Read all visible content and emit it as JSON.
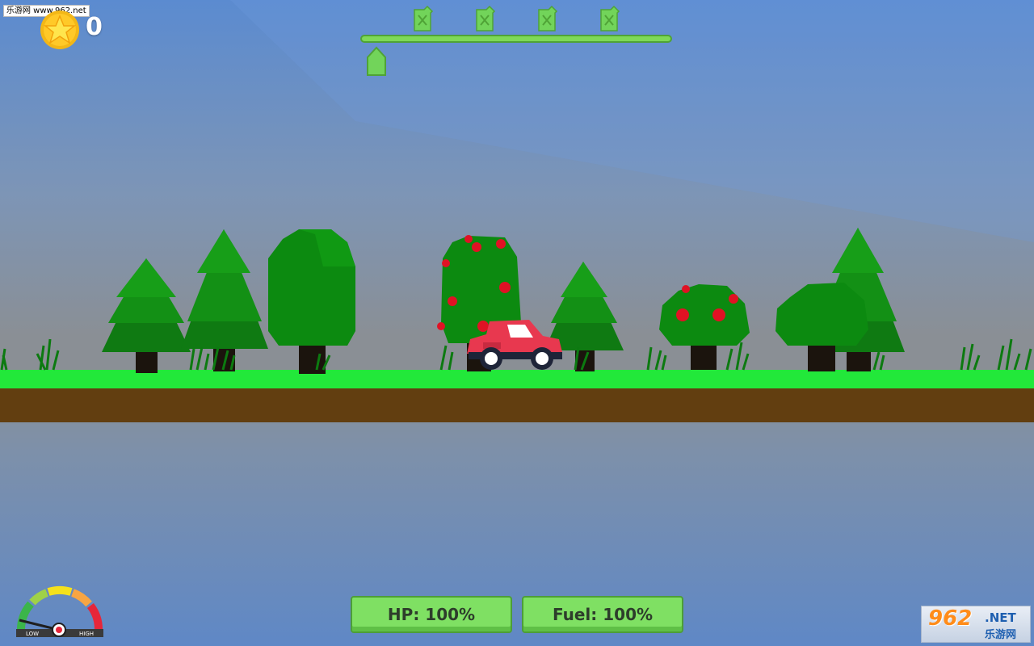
{
  "watermark": {
    "text": "乐游网 www.962.net"
  },
  "hud": {
    "score": "0",
    "hp_label": "HP: 100%",
    "fuel_label": "Fuel: 100%",
    "level_progress": 0,
    "fuel_checkpoints": 4,
    "gauge_low": "LOW",
    "gauge_high": "HIGH",
    "gauge_level": 0.05
  },
  "logo": {
    "big": "962",
    "net": ".NET",
    "cn": "乐游网"
  },
  "icons": [
    "star-icon",
    "fuel-can-icon",
    "progress-marker-icon",
    "speedometer-icon",
    "car-icon"
  ],
  "colors": {
    "grass": "#22e83a",
    "dirt": "#623e10",
    "car": "#e8384f",
    "panel": "#7fe063",
    "tree": "#0f7d14",
    "apple": "#e01224"
  }
}
